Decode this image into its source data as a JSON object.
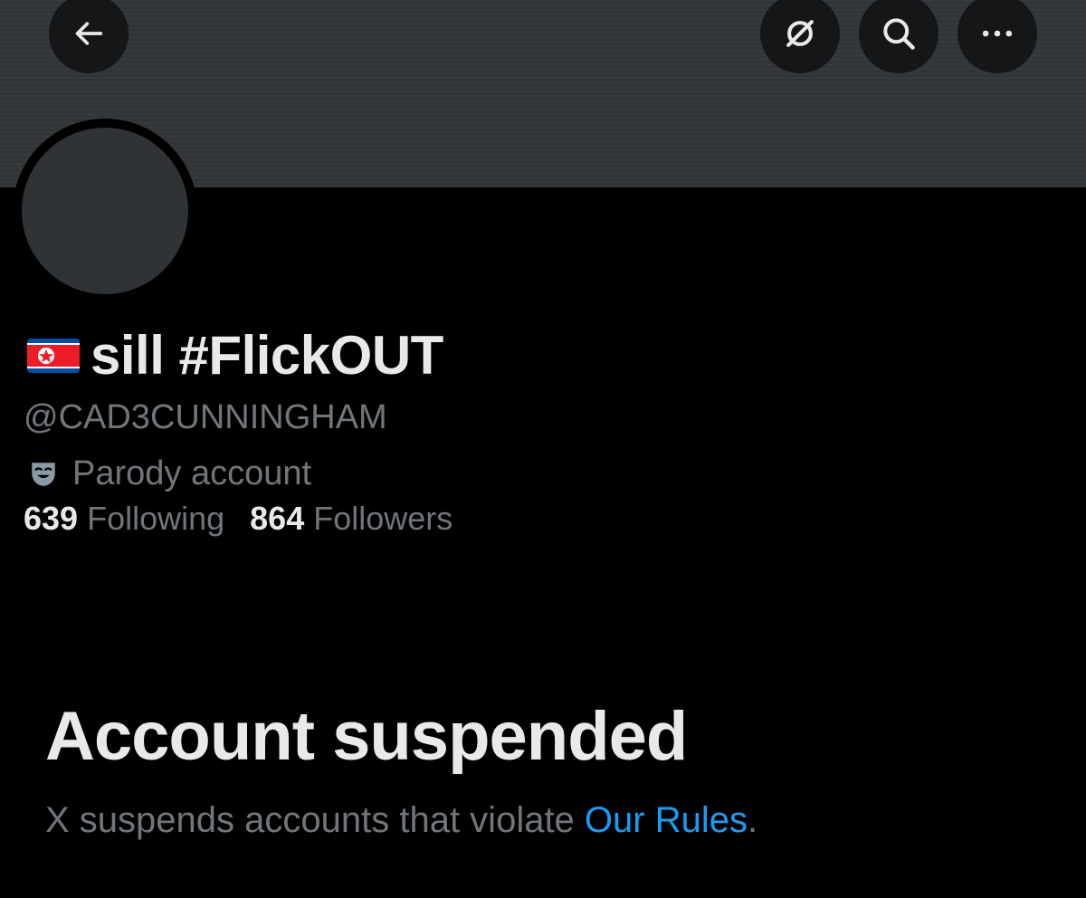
{
  "header": {
    "back_icon": "arrow-left-icon",
    "grok_icon": "grok-icon",
    "search_icon": "search-icon",
    "more_icon": "more-horizontal-icon"
  },
  "profile": {
    "flag_icon": "north-korea-flag-icon",
    "display_name": "sill #FlickOUT",
    "handle": "@CAD3CUNNINGHAM",
    "label_icon": "parody-mask-icon",
    "label_text": "Parody account",
    "following_count": "639",
    "following_label": "Following",
    "followers_count": "864",
    "followers_label": "Followers"
  },
  "suspension": {
    "title": "Account suspended",
    "description_prefix": "X suspends accounts that violate ",
    "rules_link": "Our Rules",
    "description_suffix": "."
  },
  "colors": {
    "background": "#000000",
    "banner": "#333639",
    "primary_text": "#e7e9ea",
    "secondary_text": "#71767b",
    "link": "#1d9bf0"
  }
}
